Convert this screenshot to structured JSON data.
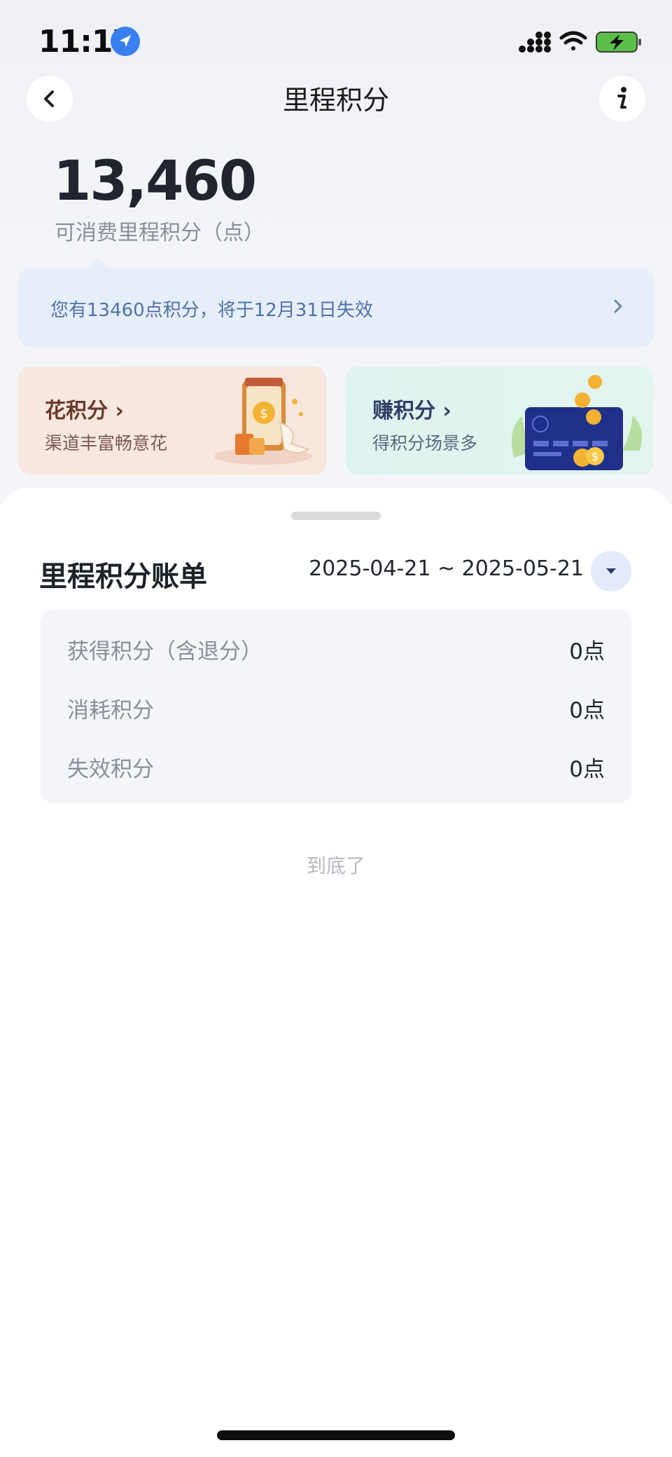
{
  "status_bar": {
    "time": "11:17",
    "location_icon": "location-arrow-icon",
    "signal_icon": "cellular-signal-icon",
    "wifi_icon": "wifi-icon",
    "battery_icon": "battery-charging-icon",
    "battery_color": "#5bc04a"
  },
  "nav": {
    "title": "里程积分",
    "back_icon": "chevron-left-icon",
    "info_icon": "info-icon"
  },
  "points": {
    "value": "13,460",
    "label": "可消费里程积分（点）"
  },
  "notice": {
    "text": "您有13460点积分，将于12月31日失效",
    "icon": "chevron-right-icon"
  },
  "cards": {
    "spend": {
      "title": "花积分",
      "subtitle": "渠道丰富畅意花",
      "chevron": "›",
      "art_icon": "phone-coin-shopping-icon"
    },
    "earn": {
      "title": "赚积分",
      "subtitle": "得积分场景多",
      "chevron": "›",
      "art_icon": "card-coins-icon"
    }
  },
  "bill": {
    "title": "里程积分账单",
    "date_range": "2025-04-21 ~ 2025-05-21",
    "dropdown_icon": "caret-down-icon",
    "rows": [
      {
        "label": "获得积分（含退分）",
        "value": "0点"
      },
      {
        "label": "消耗积分",
        "value": "0点"
      },
      {
        "label": "失效积分",
        "value": "0点"
      }
    ],
    "end_text": "到底了"
  },
  "colors": {
    "accent_blue": "#3a7ff0",
    "notice_bg": "#e6eefa",
    "notice_text": "#4f72a8"
  }
}
